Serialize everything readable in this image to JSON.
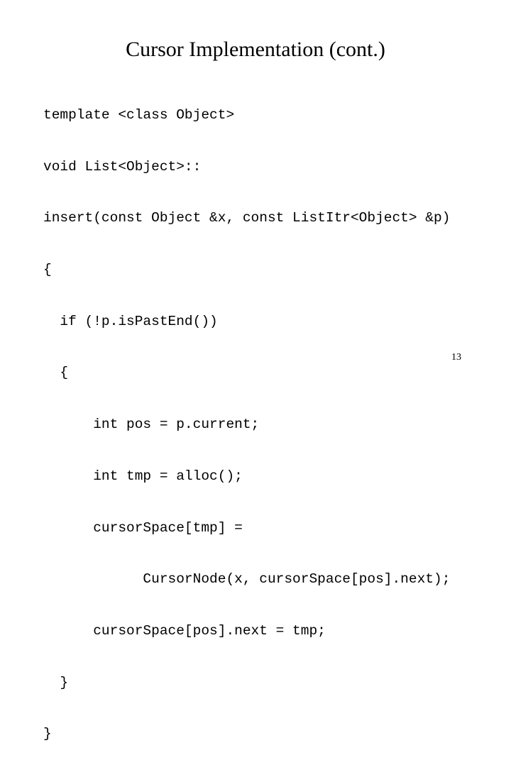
{
  "slide": {
    "title": "Cursor Implementation (cont.)",
    "code_lines": [
      "template <class Object>",
      "void List<Object>::",
      "insert(const Object &x, const ListItr<Object> &p)",
      "{",
      "  if (!p.isPastEnd())",
      "  {",
      "      int pos = p.current;",
      "      int tmp = alloc();",
      "      cursorSpace[tmp] =",
      "            CursorNode(x, cursorSpace[pos].next);",
      "      cursorSpace[pos].next = tmp;",
      "  }",
      "}"
    ],
    "page_number": "13"
  }
}
